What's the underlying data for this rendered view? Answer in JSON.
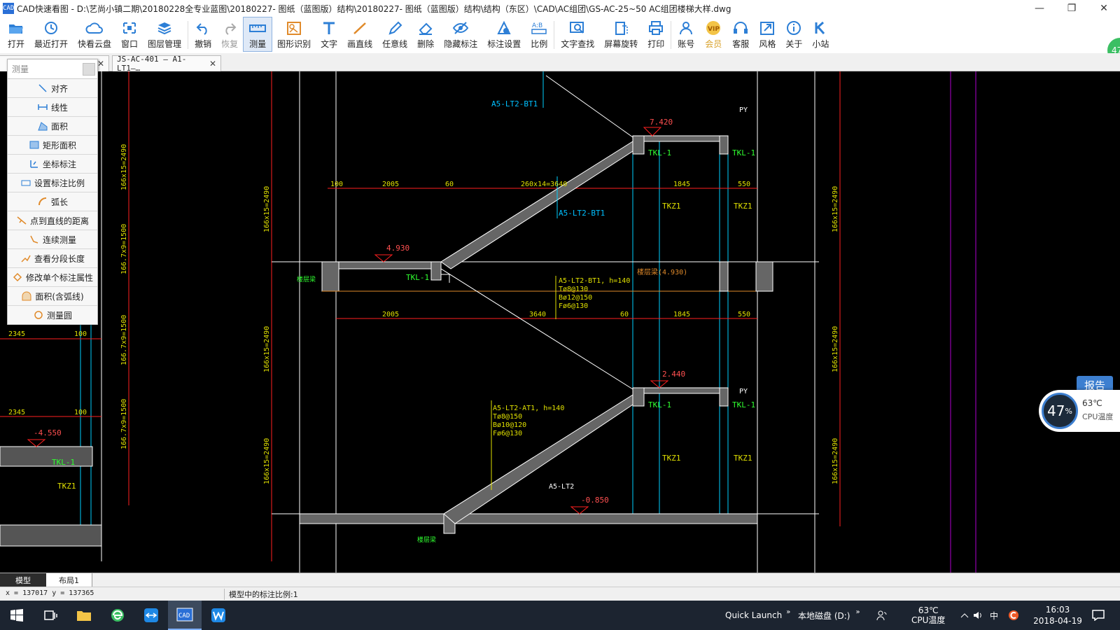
{
  "window": {
    "title": "CAD快速看图 - D:\\艺尚小镇二期\\20180228全专业蓝图\\20180227- 图纸（蓝图版）结构\\20180227- 图纸（蓝图版）结构\\结构（东区）\\CAD\\AC组团\\GS-AC-25~50 AC组团楼梯大样.dwg",
    "app_icon_text": "CAD",
    "minimize": "—",
    "maximize": "❐",
    "close": "✕"
  },
  "toolbar": {
    "items": [
      {
        "label": "打开",
        "icon": "folder-open-icon"
      },
      {
        "label": "最近打开",
        "icon": "history-icon"
      },
      {
        "label": "快看云盘",
        "icon": "cloud-icon"
      },
      {
        "label": "窗口",
        "icon": "window-icon"
      },
      {
        "label": "图层管理",
        "icon": "layers-icon"
      },
      {
        "label": "撤销",
        "icon": "undo-icon"
      },
      {
        "label": "恢复",
        "icon": "redo-icon"
      },
      {
        "label": "测量",
        "icon": "ruler-icon"
      },
      {
        "label": "图形识别",
        "icon": "shape-recognition-icon"
      },
      {
        "label": "文字",
        "icon": "text-icon"
      },
      {
        "label": "画直线",
        "icon": "line-icon"
      },
      {
        "label": "任意线",
        "icon": "pen-icon"
      },
      {
        "label": "删除",
        "icon": "eraser-icon"
      },
      {
        "label": "隐藏标注",
        "icon": "eye-hide-icon"
      },
      {
        "label": "标注设置",
        "icon": "annotation-settings-icon"
      },
      {
        "label": "比例",
        "icon": "scale-icon"
      },
      {
        "label": "文字查找",
        "icon": "text-search-icon"
      },
      {
        "label": "屏幕旋转",
        "icon": "rotate-screen-icon"
      },
      {
        "label": "打印",
        "icon": "printer-icon"
      },
      {
        "label": "账号",
        "icon": "user-icon"
      },
      {
        "label": "会员",
        "icon": "vip-icon"
      },
      {
        "label": "客服",
        "icon": "headset-icon"
      },
      {
        "label": "风格",
        "icon": "style-icon"
      },
      {
        "label": "关于",
        "icon": "info-icon"
      },
      {
        "label": "小站",
        "icon": "k-logo-icon"
      }
    ]
  },
  "doc_tabs": [
    {
      "label": "JS-AC-401 – A1-LT1–…",
      "close": "✕"
    }
  ],
  "panel_close": "✕",
  "measure_panel": {
    "placeholder": "测量",
    "items": [
      "对齐",
      "线性",
      "面积",
      "矩形面积",
      "坐标标注",
      "设置标注比例",
      "弧长",
      "点到直线的距离",
      "连续测量",
      "查看分段长度",
      "修改单个标注属性",
      "面积(含弧线)",
      "测量圆"
    ]
  },
  "layout_tabs": [
    "模型",
    "布局1"
  ],
  "status": {
    "coords": "x = 137017  y = 137365",
    "scale_text": "模型中的标注比例:1"
  },
  "gauge": {
    "percent": "47",
    "unit": "%",
    "temp": "63℃",
    "label": "CPU温度",
    "report": "报告",
    "ball": "47"
  },
  "taskbar": {
    "quick_launch": "Quick Launch",
    "drive": "本地磁盘 (D:)",
    "temp": "63℃",
    "temp_label": "CPU温度",
    "ime": "中",
    "time": "16:03",
    "date": "2018-04-19",
    "chevron": "»"
  },
  "drawing": {
    "elev_7420": "7.420",
    "elev_4930": "4.930",
    "elev_2440": "2.440",
    "elev_m0850": "-0.850",
    "elev_m4550": "-4.550",
    "py_top": "PY",
    "py_mid": "PY",
    "lbl_bt1_top": "A5-LT2-BT1",
    "lbl_bt1_mid": "A5-LT2-BT1",
    "bt1_spec": "A5-LT2-BT1, h=140",
    "bt1_t": "Tø8@130",
    "bt1_b": "Bø12@150",
    "bt1_f": "Fø6@130",
    "at1_spec": "A5-LT2-AT1, h=140",
    "at1_t": "Tø8@150",
    "at1_b": "Bø10@120",
    "at1_f": "Fø6@130",
    "lt2": "A5-LT2",
    "tkl1": "TKL-1",
    "tkz1": "TKZ1",
    "dim_2005": "2005",
    "dim_60": "60",
    "dim_260x14": "260x14=3640",
    "dim_1845": "1845",
    "dim_550": "550",
    "dim_3640": "3640",
    "dim_100": "100",
    "dim_2345": "2345",
    "slab_label": "楼层梁(4.930)",
    "left_dim": "166x15=2490",
    "left_dim2": "166.7x9=1500",
    "ground": "楼层梁"
  }
}
